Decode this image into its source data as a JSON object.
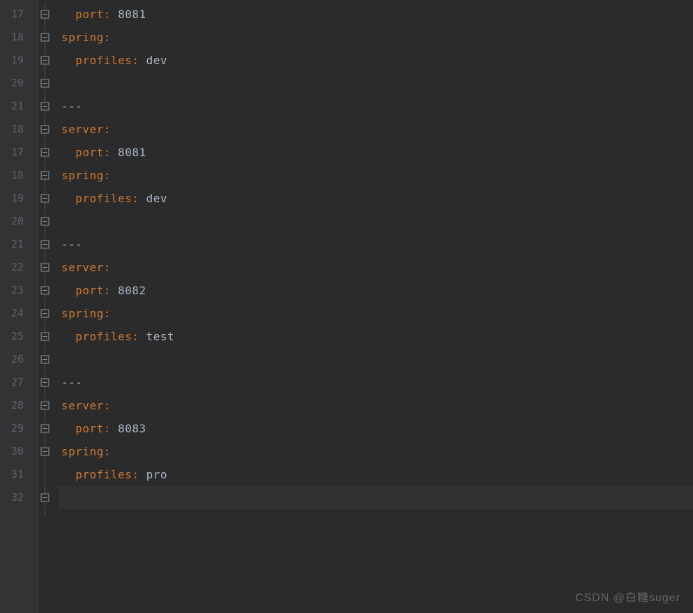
{
  "lineNumbers": [
    "17",
    "18",
    "19",
    "20",
    "21",
    "18",
    "17",
    "18",
    "19",
    "20",
    "21",
    "22",
    "23",
    "24",
    "25",
    "26",
    "27",
    "28",
    "29",
    "30",
    "31",
    "32"
  ],
  "lines": [
    {
      "indent": 2,
      "key": "port",
      "value": "8081",
      "type": "kv",
      "fold": "close"
    },
    {
      "indent": 0,
      "key": "spring",
      "value": "",
      "type": "k",
      "fold": "open"
    },
    {
      "indent": 2,
      "key": "profiles",
      "value": "dev",
      "type": "kv",
      "fold": "close"
    },
    {
      "indent": 0,
      "type": "empty",
      "fold": "close"
    },
    {
      "indent": 0,
      "type": "sep",
      "text": "---",
      "fold": "open"
    },
    {
      "indent": 0,
      "key": "server",
      "value": "",
      "type": "k",
      "fold": "open"
    },
    {
      "indent": 2,
      "key": "port",
      "value": "8081",
      "type": "kv",
      "fold": "close"
    },
    {
      "indent": 0,
      "key": "spring",
      "value": "",
      "type": "k",
      "fold": "open"
    },
    {
      "indent": 2,
      "key": "profiles",
      "value": "dev",
      "type": "kv",
      "fold": "close"
    },
    {
      "indent": 0,
      "type": "empty",
      "fold": "close"
    },
    {
      "indent": 0,
      "type": "sep",
      "text": "---",
      "fold": "open"
    },
    {
      "indent": 0,
      "key": "server",
      "value": "",
      "type": "k",
      "fold": "open"
    },
    {
      "indent": 2,
      "key": "port",
      "value": "8082",
      "type": "kv",
      "fold": "close"
    },
    {
      "indent": 0,
      "key": "spring",
      "value": "",
      "type": "k",
      "fold": "open"
    },
    {
      "indent": 2,
      "key": "profiles",
      "value": "test",
      "type": "kv",
      "fold": "close"
    },
    {
      "indent": 0,
      "type": "empty",
      "fold": "close"
    },
    {
      "indent": 0,
      "type": "sep",
      "text": "---",
      "fold": "open"
    },
    {
      "indent": 0,
      "key": "server",
      "value": "",
      "type": "k",
      "fold": "open"
    },
    {
      "indent": 2,
      "key": "port",
      "value": "8083",
      "type": "kv",
      "fold": "close"
    },
    {
      "indent": 0,
      "key": "spring",
      "value": "",
      "type": "k",
      "fold": "open"
    },
    {
      "indent": 2,
      "key": "profiles",
      "value": "pro",
      "type": "kv",
      "fold": "none"
    },
    {
      "indent": 0,
      "type": "empty",
      "fold": "close",
      "current": true
    }
  ],
  "watermark": "CSDN @白糖suger"
}
